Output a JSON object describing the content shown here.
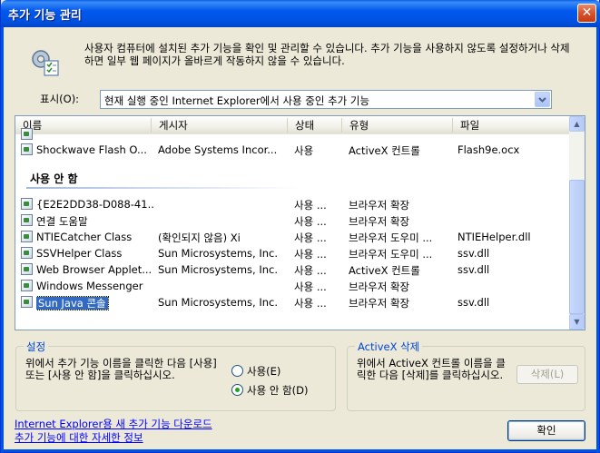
{
  "window": {
    "title": "추가 기능 관리",
    "close_glyph": "✕"
  },
  "description": "사용자 컴퓨터에 설치된 추가 기능을 확인 및 관리할 수 있습니다. 추가 기능을 사용하지 않도록 설정하거나 삭제하면 일부 웹 페이지가 올바르게 작동하지 않을 수 있습니다.",
  "show": {
    "label": "표시(O):",
    "selected": "현재 실행 중인 Internet Explorer에서 사용 중인 추가 기능"
  },
  "list": {
    "columns": [
      "이름",
      "게시자",
      "상태",
      "유형",
      "파일"
    ],
    "top_rows": [
      {
        "name": "Shockwave Flash O...",
        "publisher": "Adobe Systems Incor...",
        "status": "사용",
        "type": "ActiveX 컨트롤",
        "file": "Flash9e.ocx"
      }
    ],
    "group_title": "사용 안 함",
    "disabled_rows": [
      {
        "name": "{E2E2DD38-D088-41...",
        "publisher": "",
        "status": "사용 ...",
        "type": "브라우저 확장",
        "file": ""
      },
      {
        "name": "연결 도움말",
        "publisher": "",
        "status": "사용 ...",
        "type": "브라우저 확장",
        "file": ""
      },
      {
        "name": "NTIECatcher Class",
        "publisher": "(확인되지 않음) Xi",
        "status": "사용 ...",
        "type": "브라우저 도우미 ...",
        "file": "NTIEHelper.dll"
      },
      {
        "name": "SSVHelper Class",
        "publisher": "Sun Microsystems, Inc.",
        "status": "사용 ...",
        "type": "브라우저 도우미 ...",
        "file": "ssv.dll"
      },
      {
        "name": "Web Browser Applet...",
        "publisher": "Sun Microsystems, Inc.",
        "status": "사용 ...",
        "type": "ActiveX 컨트롤",
        "file": "ssv.dll"
      },
      {
        "name": "Windows Messenger",
        "publisher": "",
        "status": "사용 ...",
        "type": "브라우저 확장",
        "file": ""
      },
      {
        "name": "Sun Java 콘솔",
        "publisher": "Sun Microsystems, Inc.",
        "status": "사용 ...",
        "type": "브라우저 확장",
        "file": "ssv.dll"
      }
    ]
  },
  "settings": {
    "legend": "설정",
    "text": "위에서 추가 기능 이름을 클릭한 다음 [사용] 또는 [사용 안 함]을 클릭하십시오.",
    "enable_label": "사용(E)",
    "disable_label": "사용 안 함(D)",
    "selected": "disable"
  },
  "activex": {
    "legend": "ActiveX 삭제",
    "text": "위에서 ActiveX 컨트롤 이름을 클릭한 다음 [삭제]를 클릭하십시오.",
    "delete_label": "삭제(L)"
  },
  "links": {
    "download": "Internet Explorer용 새 추가 기능 다운로드",
    "info": "추가 기능에 대한 자세한 정보"
  },
  "ok_label": "확인"
}
